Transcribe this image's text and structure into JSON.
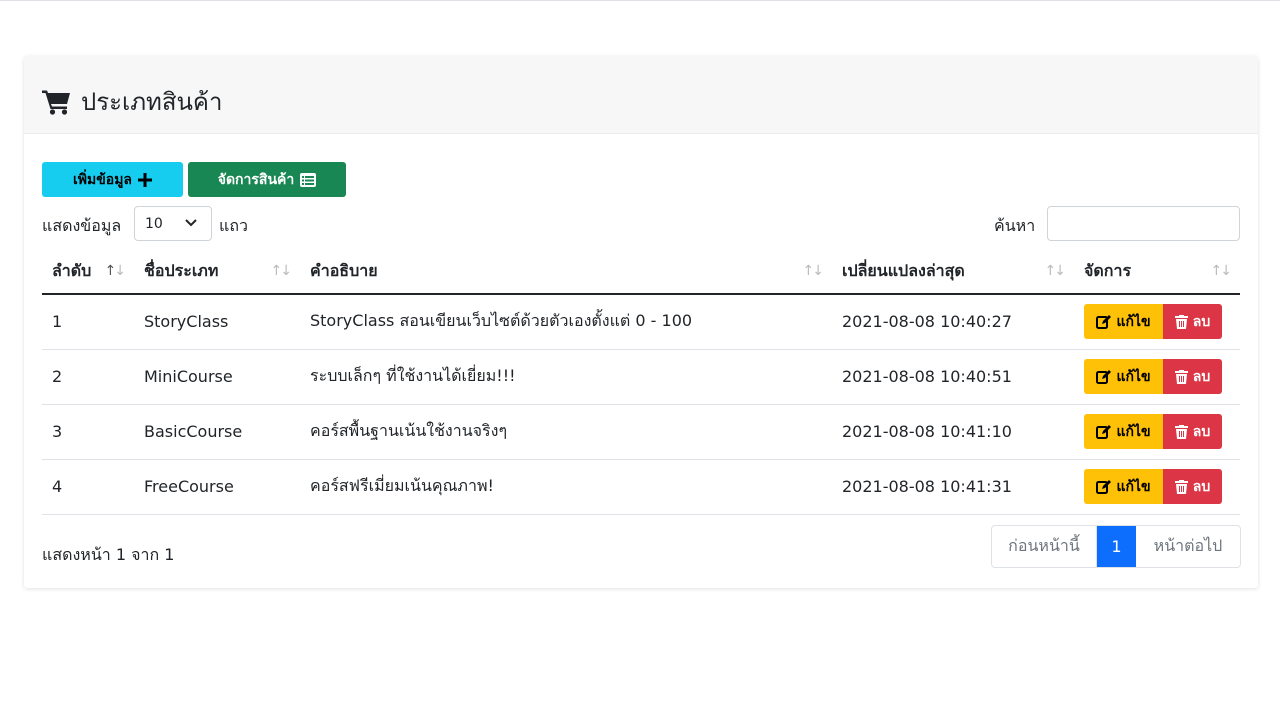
{
  "page": {
    "title": "ประเภทสินค้า",
    "accent_color": "#0d6efd"
  },
  "toolbar": {
    "add_label": "เพิ่มข้อมูล",
    "add_icon": "plus-icon",
    "manage_label": "จัดการสินค้า",
    "manage_icon": "list-icon"
  },
  "length_menu": {
    "prefix": "แสดงข้อมูล",
    "selected": "10",
    "suffix": "แถว"
  },
  "search": {
    "label": "ค้นหา",
    "value": ""
  },
  "table": {
    "columns": [
      "ลำดับ",
      "ชื่อประเภท",
      "คำอธิบาย",
      "เปลี่ยนแปลงล่าสุด",
      "จัดการ"
    ],
    "rows": [
      {
        "no": "1",
        "name": "StoryClass",
        "desc": "StoryClass สอนเขียนเว็บไซต์ด้วยตัวเองตั้งแต่ 0 - 100",
        "updated": "2021-08-08 10:40:27"
      },
      {
        "no": "2",
        "name": "MiniCourse",
        "desc": "ระบบเล็กๆ ที่ใช้งานได้เยี่ยม!!!",
        "updated": "2021-08-08 10:40:51"
      },
      {
        "no": "3",
        "name": "BasicCourse",
        "desc": "คอร์สพื้นฐานเน้นใช้งานจริงๆ",
        "updated": "2021-08-08 10:41:10"
      },
      {
        "no": "4",
        "name": "FreeCourse",
        "desc": "คอร์สฟรีเมี่ยมเน้นคุณภาพ!",
        "updated": "2021-08-08 10:41:31"
      }
    ],
    "edit_label": "แก้ไข",
    "delete_label": "ลบ"
  },
  "footer": {
    "info": "แสดงหน้า 1 จาก 1",
    "prev": "ก่อนหน้านี้",
    "page": "1",
    "next": "หน้าต่อไป"
  }
}
